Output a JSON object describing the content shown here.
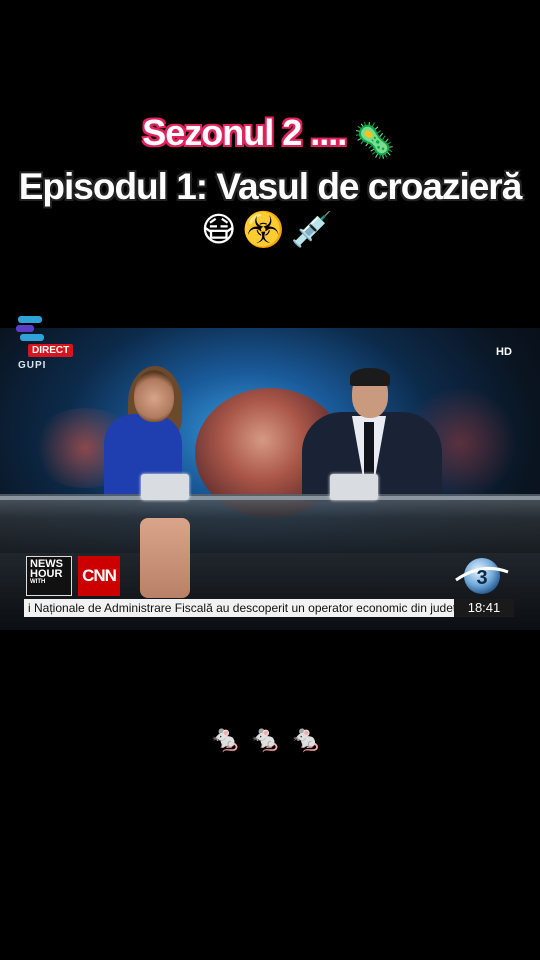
{
  "caption": {
    "line1": "Sezonul 2 ....",
    "line1_emoji": "🦠",
    "line2": "Episodul 1: Vasul de croazieră",
    "line3_emojis": "😷☣️💉"
  },
  "broadcast": {
    "logo_badge": "DIRECT",
    "logo_name": "GUPI",
    "quality_badge": "HD",
    "show_brand_line1": "NEWS",
    "show_brand_line2": "HOUR",
    "show_brand_with": "WITH",
    "partner_logo": "CNN",
    "ticker_text": "i Naționale de Administrare Fiscală au descoperit un operator economic din județul I",
    "clock": "18:41"
  },
  "footer_emojis": "🐁🐁🐁",
  "colors": {
    "caption_outline": "#e0245e",
    "direct_red": "#d6161e",
    "cnn_red": "#cc0000"
  }
}
